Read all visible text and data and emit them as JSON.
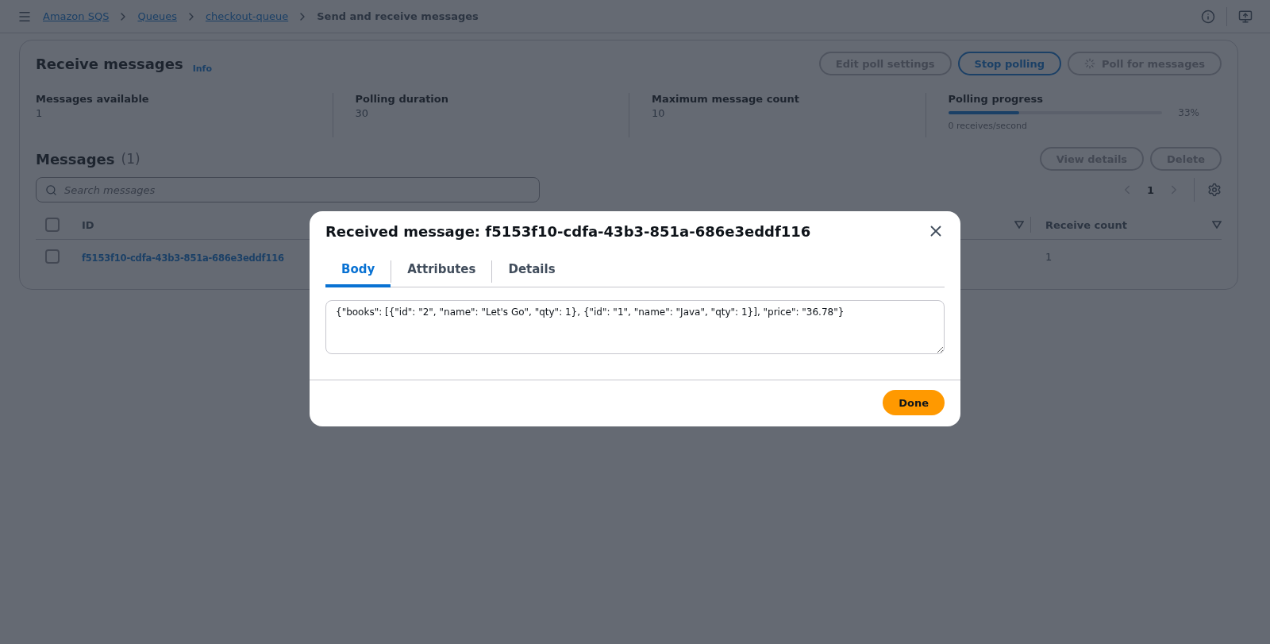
{
  "breadcrumbs": [
    {
      "label": "Amazon SQS",
      "link": true
    },
    {
      "label": "Queues",
      "link": true
    },
    {
      "label": "checkout-queue",
      "link": true
    },
    {
      "label": "Send and receive messages",
      "link": false
    }
  ],
  "panel": {
    "title": "Receive messages",
    "info": "Info",
    "buttons": [
      {
        "label": "Edit poll settings",
        "kind": "normal"
      },
      {
        "label": "Stop polling",
        "kind": "primary"
      },
      {
        "label": "Poll for messages",
        "kind": "loading"
      }
    ],
    "stats": [
      {
        "label": "Messages available",
        "value": "1"
      },
      {
        "label": "Polling duration",
        "value": "30"
      },
      {
        "label": "Maximum message count",
        "value": "10"
      }
    ],
    "progress": {
      "label": "Polling progress",
      "level": 0.33,
      "reading": "33%",
      "rate": "0 receives/second"
    }
  },
  "messages": {
    "title": "Messages",
    "count": "(1)",
    "buttons": [
      "View details",
      "Delete"
    ],
    "search": {
      "placeholder": "Search messages"
    },
    "page": "1",
    "select_all": {
      "checked": false
    },
    "columns": [
      {
        "label": "ID"
      },
      {
        "label": "Receive count"
      }
    ],
    "rows": [
      {
        "selected": false,
        "id": "f5153f10-cdfa-43b3-851a-686e3eddf116",
        "receive_count": "1"
      }
    ]
  },
  "modal": {
    "title": "Received message: f5153f10-cdfa-43b3-851a-686e3eddf116",
    "tabs": [
      {
        "label": "Body",
        "selected": true
      },
      {
        "label": "Attributes",
        "selected": false
      },
      {
        "label": "Details",
        "selected": false
      }
    ],
    "body": "{\"books\": [{\"id\": \"2\", \"name\": \"Let's Go\", \"qty\": 1}, {\"id\": \"1\", \"name\": \"Java\", \"qty\": 1}], \"price\": \"36.78\"}",
    "button": "Done"
  }
}
